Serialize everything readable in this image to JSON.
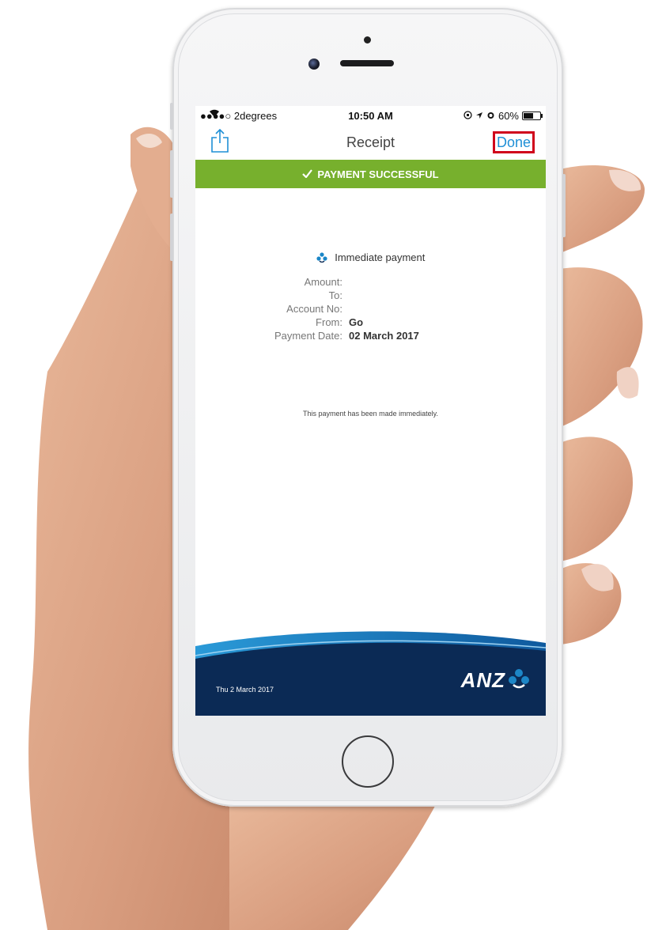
{
  "status_bar": {
    "carrier": "●●●●○ 2degrees",
    "time": "10:50 AM",
    "battery_percent": "60%",
    "battery_level": 0.6
  },
  "nav": {
    "title": "Receipt",
    "done_label": "Done",
    "share_icon": "share-icon"
  },
  "banner": {
    "label": "PAYMENT SUCCESSFUL",
    "color": "#77b02d"
  },
  "payment": {
    "type": "Immediate payment",
    "fields": [
      {
        "label": "Amount:",
        "value": ""
      },
      {
        "label": "To:",
        "value": ""
      },
      {
        "label": "Account No:",
        "value": ""
      },
      {
        "label": "From:",
        "value": "Go"
      },
      {
        "label": "Payment Date:",
        "value": "02 March 2017"
      }
    ],
    "note": "This payment has been made immediately."
  },
  "footer": {
    "date": "Thu 2 March 2017",
    "logo_text": "ANZ",
    "colors": {
      "dark": "#0b2a55",
      "light": "#1d86c6"
    }
  },
  "accent": {
    "link": "#1f8fd6",
    "highlight": "#d0021b"
  }
}
